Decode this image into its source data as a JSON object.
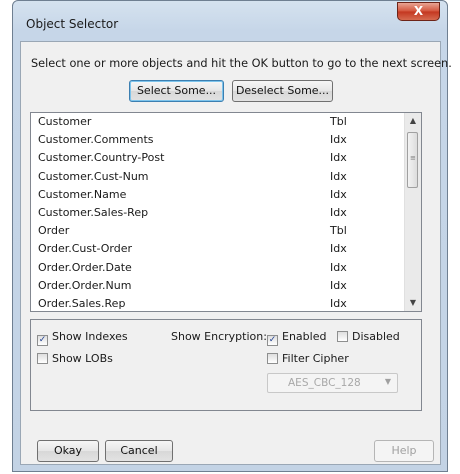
{
  "window": {
    "title": "Object Selector",
    "close_glyph": "X"
  },
  "instruction": "Select one or more objects and hit the OK button to go to the next screen.",
  "buttons": {
    "select_some": "Select Some...",
    "deselect_some": "Deselect Some...",
    "okay": "Okay",
    "cancel": "Cancel",
    "help": "Help"
  },
  "objects": [
    {
      "name": "Customer",
      "type": "Tbl"
    },
    {
      "name": "Customer.Comments",
      "type": "Idx"
    },
    {
      "name": "Customer.Country-Post",
      "type": "Idx"
    },
    {
      "name": "Customer.Cust-Num",
      "type": "Idx"
    },
    {
      "name": "Customer.Name",
      "type": "Idx"
    },
    {
      "name": "Customer.Sales-Rep",
      "type": "Idx"
    },
    {
      "name": "Order",
      "type": "Tbl"
    },
    {
      "name": "Order.Cust-Order",
      "type": "Idx"
    },
    {
      "name": "Order.Order.Date",
      "type": "Idx"
    },
    {
      "name": "Order.Order.Num",
      "type": "Idx"
    },
    {
      "name": "Order.Sales.Rep",
      "type": "Idx"
    }
  ],
  "options": {
    "show_indexes": {
      "label": "Show Indexes",
      "checked": true
    },
    "show_lobs": {
      "label": "Show LOBs",
      "checked": false
    },
    "show_encryption_label": "Show Encryption:",
    "enabled": {
      "label": "Enabled",
      "checked": true
    },
    "disabled": {
      "label": "Disabled",
      "checked": false
    },
    "filter_cipher": {
      "label": "Filter Cipher",
      "checked": false
    },
    "cipher_value": "AES_CBC_128"
  },
  "colors": {
    "frame": "#c6d6e8",
    "client": "#f0f0f0",
    "close_button": "#c3361f",
    "default_button_glow": "#7dc4ec"
  }
}
